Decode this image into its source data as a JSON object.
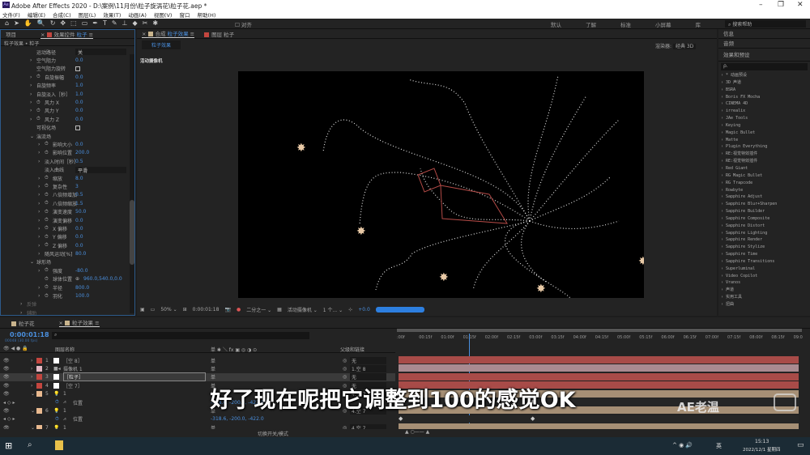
{
  "window": {
    "title": "Adobe After Effects 2020 - D:\\案例\\11月份\\粒子旋涡花\\粒子花.aep *",
    "logo": "Ae",
    "min": "–",
    "max": "❐",
    "close": "✕"
  },
  "menu": [
    "文件(F)",
    "编辑(E)",
    "合成(C)",
    "图层(L)",
    "效果(T)",
    "动画(A)",
    "视图(V)",
    "窗口",
    "帮助(H)"
  ],
  "toolbar": {
    "tools": [
      "⌂",
      "➤",
      "✋",
      "🔍",
      "↻",
      "✥",
      "⬚",
      "▭",
      "✒",
      "T",
      "✎",
      "⊥",
      "◆",
      "✂",
      "✱"
    ],
    "snap_label": "对齐",
    "workspaces": [
      "默认",
      "了解",
      "标准",
      "小屏幕",
      "库",
      "»"
    ],
    "search_placeholder": "搜索帮助"
  },
  "left_panel": {
    "tabs": {
      "project": "项目",
      "effect_controls": "效果控件",
      "layer": "粒子"
    },
    "breadcrumb": "粒子效果 • 粒子",
    "props": [
      {
        "i": 0,
        "label": "运动路径",
        "dd": "关"
      },
      {
        "i": 0,
        "label": "空气阻力",
        "value": "0.0",
        "arrow": true
      },
      {
        "i": 0,
        "label": "空气阻力旋转",
        "check": true
      },
      {
        "i": 0,
        "label": "自旋振幅",
        "value": "0.0",
        "arrow": true,
        "sw": true
      },
      {
        "i": 0,
        "label": "自旋频率",
        "value": "1.0",
        "arrow": true
      },
      {
        "i": 0,
        "label": "自旋淡入［秒］",
        "value": "1.0",
        "arrow": true
      },
      {
        "i": 0,
        "label": "风力 X",
        "value": "0.0",
        "arrow": true,
        "sw": true
      },
      {
        "i": 0,
        "label": "风力 Y",
        "value": "0.0",
        "arrow": true,
        "sw": true
      },
      {
        "i": 0,
        "label": "风力 Z",
        "value": "0.0",
        "arrow": true,
        "sw": true
      },
      {
        "i": 0,
        "label": "可视化场",
        "check": true
      },
      {
        "i": 0,
        "label": "湍流场",
        "open": true
      },
      {
        "i": 1,
        "label": "影响大小",
        "value": "0.0",
        "arrow": true,
        "sw": true
      },
      {
        "i": 1,
        "label": "影响位置",
        "value": "200.0",
        "arrow": true,
        "sw": true
      },
      {
        "i": 1,
        "label": "淡入时间［秒］",
        "value": "0.5",
        "arrow": true
      },
      {
        "i": 1,
        "label": "淡入曲线",
        "dd": "平滑"
      },
      {
        "i": 1,
        "label": "缩放",
        "value": "8.0",
        "arrow": true,
        "sw": true
      },
      {
        "i": 1,
        "label": "复杂性",
        "value": "3",
        "arrow": true,
        "sw": true
      },
      {
        "i": 1,
        "label": "八倍频增加",
        "value": "0.5",
        "arrow": true,
        "sw": true
      },
      {
        "i": 1,
        "label": "八倍频缩放",
        "value": "1.5",
        "arrow": true,
        "sw": true
      },
      {
        "i": 1,
        "label": "演变速度",
        "value": "50.0",
        "arrow": true,
        "sw": true
      },
      {
        "i": 1,
        "label": "演变偏移",
        "value": "0.0",
        "arrow": true,
        "sw": true
      },
      {
        "i": 1,
        "label": "X 偏移",
        "value": "0.0",
        "arrow": true,
        "sw": true
      },
      {
        "i": 1,
        "label": "Y 偏移",
        "value": "0.0",
        "arrow": true,
        "sw": true
      },
      {
        "i": 1,
        "label": "Z 偏移",
        "value": "0.0",
        "arrow": true,
        "sw": true
      },
      {
        "i": 1,
        "label": "随风运动[%]",
        "value": "80.0",
        "arrow": true
      },
      {
        "i": 0,
        "label": "球形场",
        "open": true
      },
      {
        "i": 1,
        "label": "强度",
        "value": "-80.0",
        "arrow": true,
        "sw": true
      },
      {
        "i": 1,
        "label": "球体位置",
        "value": "960.0,540.0,0.0",
        "sw": true,
        "target": true
      },
      {
        "i": 1,
        "label": "半径",
        "value": "800.0",
        "arrow": true,
        "sw": true
      },
      {
        "i": 1,
        "label": "羽化",
        "value": "100.0",
        "arrow": true,
        "sw": true
      },
      {
        "i": -1,
        "label": "反弹",
        "arrow": true
      },
      {
        "i": -1,
        "label": "辅助",
        "arrow": true
      }
    ]
  },
  "comp": {
    "tab_comp": "合成",
    "comp_name": "粒子效果",
    "tab_layer": "图层 粒子",
    "subtab": "粒子效果",
    "renderer_label": "渲染器:",
    "renderer": "经典 3D",
    "camera_label": "活动摄像机",
    "viewbar": {
      "zoom": "50%",
      "time": "0:00:01:18",
      "resolution": "二分之一",
      "camera": "活动摄像机",
      "views": "1 个...",
      "exposure": "+0.0"
    }
  },
  "right_panel": {
    "info": "信息",
    "audio": "音频",
    "effects": "效果和预设",
    "search_placeholder": "ρ.",
    "items": [
      "* 动画预设",
      "3D 声道",
      "BSRA",
      "Boris FX Mocha",
      "CINEMA 4D",
      "irrealix",
      "JAe Tools",
      "Keying",
      "Magic Bullet",
      "Matte",
      "Plugin Everything",
      "RE:视觉特效插件",
      "RE:视觉特效插件",
      "Red Giant",
      "RG Magic Bullet",
      "RG Trapcode",
      "Rowbyte",
      "Sapphire Adjust",
      "Sapphire Blur+Sharpen",
      "Sapphire Builder",
      "Sapphire Composite",
      "Sapphire Distort",
      "Sapphire Lighting",
      "Sapphire Render",
      "Sapphire Stylize",
      "Sapphire Time",
      "Sapphire Transitions",
      "Superluminal",
      "Video Copilot",
      "Vranos",
      "声道",
      "实用工具",
      "扭曲"
    ]
  },
  "timeline": {
    "tabs": [
      "粒子花",
      "粒子效果"
    ],
    "timecode": "0:00:01:18",
    "frames": "00048 (30.00 fps)",
    "col_name": "图层名称",
    "col_switches": "单 ✱ ＼ fx ▣ ◎ ◑ ⊙",
    "col_parent": "父级和链接",
    "ruler": [
      ":00f",
      "00:15f",
      "01:00f",
      "01:15f",
      "02:00f",
      "02:15f",
      "03:00f",
      "03:15f",
      "04:00f",
      "04:15f",
      "05:00f",
      "05:15f",
      "06:00f",
      "06:15f",
      "07:00f",
      "07:15f",
      "08:00f",
      "08:15f",
      "09:0"
    ],
    "playhead_seconds": 1.6,
    "layers": [
      {
        "num": "1",
        "name": "［空 8］",
        "color": "#c4463f",
        "parent": "无",
        "bar": "#a84b48",
        "icon": "solid"
      },
      {
        "num": "2",
        "name": "摄像机 1",
        "color": "#e4b9c4",
        "parent": "1.空 8",
        "bar": "#a98a90",
        "icon": "camera"
      },
      {
        "num": "3",
        "name": "［粒子］",
        "color": "#c4463f",
        "parent": "无",
        "bar": "#a84b48",
        "icon": "solid",
        "selected": true
      },
      {
        "num": "4",
        "name": "［空 7］",
        "color": "#c4463f",
        "parent": "无",
        "bar": "#a84b48",
        "icon": "solid"
      },
      {
        "num": "5",
        "name": "1",
        "color": "#e9b98f",
        "parent": "4.空 7",
        "bar": "#a68f75",
        "icon": "light",
        "position": "-318.6, -200.0, -422.0"
      },
      {
        "num": "6",
        "name": "1",
        "color": "#e9b98f",
        "parent": "4.空 7",
        "bar": "#a68f75",
        "icon": "light",
        "position": "-318.6, -200.0, -422.0"
      },
      {
        "num": "7",
        "name": "1",
        "color": "#e9b98f",
        "parent": "4.空 7",
        "bar": "#a68f75",
        "icon": "light"
      }
    ],
    "position_label": "位置",
    "toggle_label": "切换开关/模式"
  },
  "subtitle": "好了现在呢把它调整到100的感觉OK",
  "watermark": "AE老温",
  "taskbar": {
    "time": "15:13",
    "date": "2022/12/1 星期四",
    "ime": "英"
  }
}
